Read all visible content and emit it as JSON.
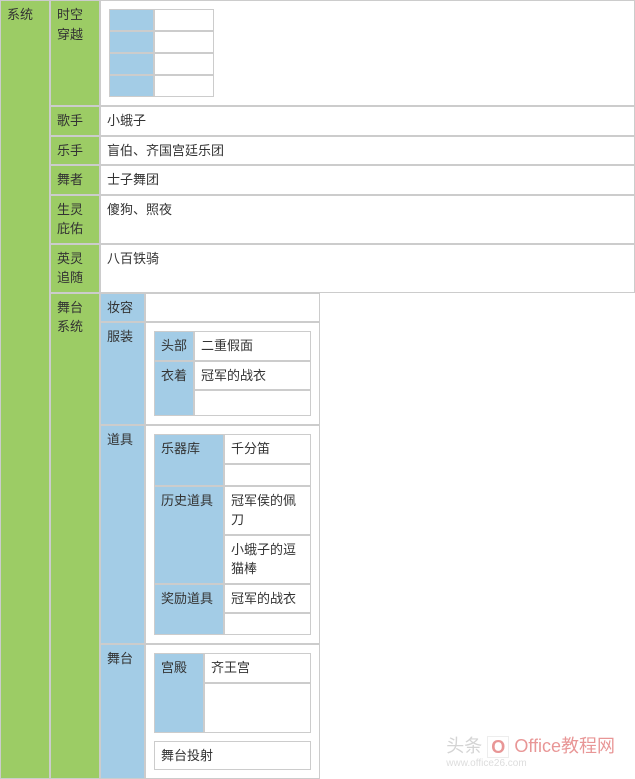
{
  "root_label": "系统",
  "rows": {
    "time_travel": {
      "label": "时空穿越"
    },
    "singer": {
      "label": "歌手",
      "value": "小蛾子"
    },
    "musician": {
      "label": "乐手",
      "value": "盲伯、齐国宫廷乐团"
    },
    "dancer": {
      "label": "舞者",
      "value": "士子舞团"
    },
    "spirit": {
      "label": "生灵庇佑",
      "value": "傻狗、照夜"
    },
    "hero": {
      "label": "英灵追随",
      "value": "八百铁骑"
    },
    "stage_system": {
      "label": "舞台系统"
    }
  },
  "stage": {
    "makeup": {
      "label": "妆容"
    },
    "costume": {
      "label": "服装",
      "head": {
        "label": "头部",
        "value": "二重假面"
      },
      "clothes": {
        "label": "衣着",
        "value": "冠军的战衣"
      }
    },
    "props": {
      "label": "道具",
      "instrument": {
        "label": "乐器库",
        "value": "千分笛"
      },
      "history": {
        "label": "历史道具",
        "value1": "冠军侯的佩刀",
        "value2": "小蛾子的逗猫棒"
      },
      "reward": {
        "label": "奖励道具",
        "value": "冠军的战衣"
      }
    },
    "stage_sub": {
      "label": "舞台",
      "palace": {
        "label": "宫殿",
        "value": "齐王宫"
      },
      "projection": {
        "label": "舞台投射"
      }
    }
  },
  "watermark": {
    "brand": "Office教程网",
    "url": "www.office26.com",
    "prefix": "头条"
  }
}
